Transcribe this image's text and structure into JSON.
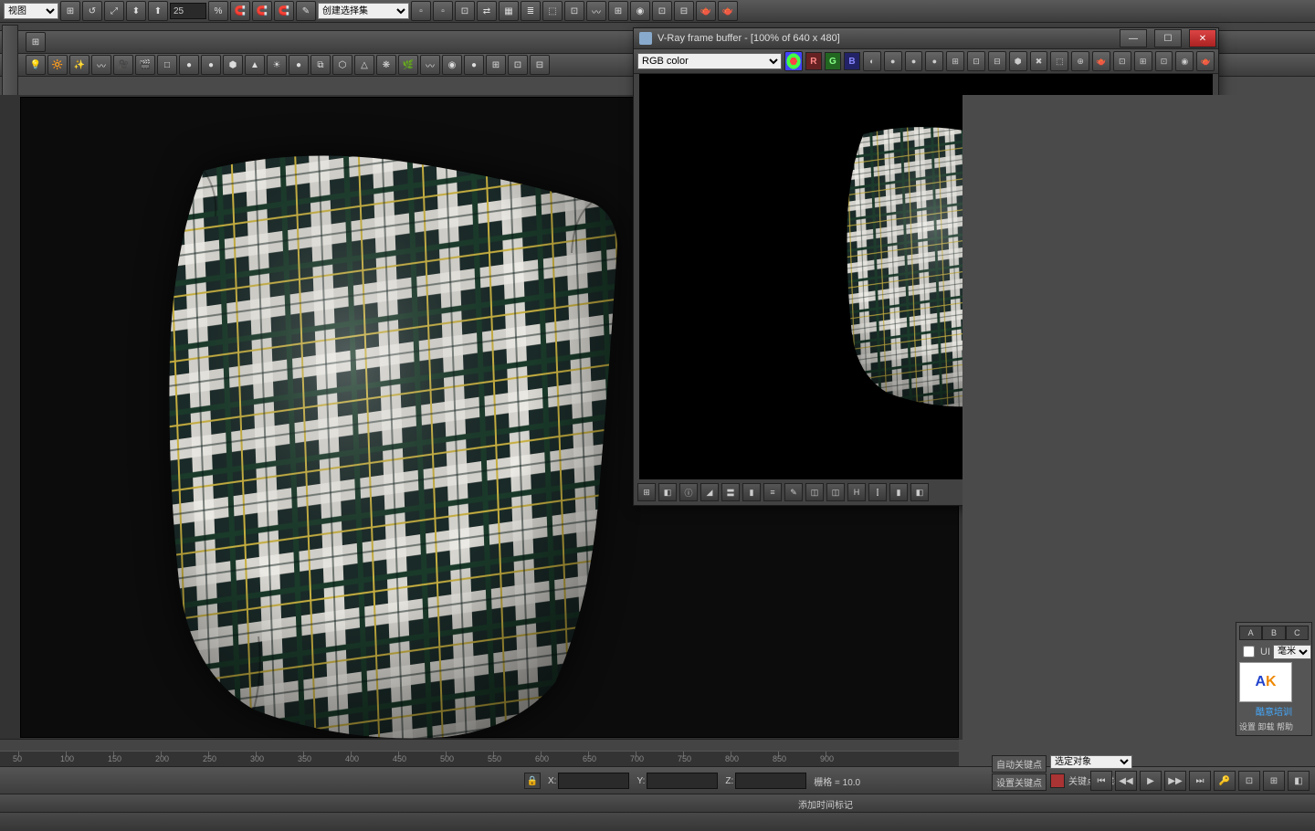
{
  "top": {
    "view_dd": "视图",
    "spin": "25",
    "sel_dd": "创建选择集"
  },
  "tb2_icons": [
    "💡",
    "🔆",
    "✨",
    "〰",
    "🎥",
    "🎬",
    "□",
    "●",
    "●",
    "⬢",
    "▲",
    "☀",
    "●",
    "⧉",
    "⬡",
    "△",
    "❋",
    "🌿",
    "〰",
    "◉",
    "●",
    "⊞",
    "⊡",
    "⊟"
  ],
  "vfb": {
    "title": "V-Ray frame buffer - [100% of 640 x 480]",
    "channel": "RGB color",
    "rgb": [
      "R",
      "G",
      "B"
    ],
    "tool_ic": [
      "◐",
      "●",
      "●",
      "●",
      "⊞",
      "⊡",
      "⊟",
      "⬢",
      "✖",
      "⬚",
      "⊕",
      "🫖",
      "⊡",
      "⊞",
      "⊡",
      "◉",
      "🫖"
    ],
    "bot_ic": [
      "⊞",
      "◧",
      "ⓘ",
      "◢",
      "〓",
      "▮",
      "≡",
      "✎",
      "◫",
      "◫",
      "H",
      "⫿",
      "▮",
      "◧"
    ]
  },
  "ruler_ticks": [
    50,
    100,
    150,
    200,
    250,
    300,
    350,
    400,
    450,
    500,
    550,
    600,
    650,
    700,
    750,
    800,
    850,
    900
  ],
  "status": {
    "x": "X:",
    "y": "Y:",
    "z": "Z:",
    "xv": "",
    "yv": "",
    "zv": "",
    "grid": "栅格 = 10.0",
    "add_marker": "添加时间标记",
    "auto_key": "自动关键点",
    "set_key": "设置关键点",
    "sel_obj": "选定对象",
    "key_label": "关键点过滤器",
    "settings": "设置 卸载 帮助",
    "ui": "UI",
    "unit": "毫米"
  },
  "rpanel": {
    "tabs": [
      "A",
      "B",
      "C"
    ],
    "caption": "酷意培训"
  },
  "anim": [
    "⏮",
    "◀◀",
    "▶",
    "▶▶",
    "⏭",
    "🔑",
    "⊡",
    "⊞",
    "◧"
  ]
}
